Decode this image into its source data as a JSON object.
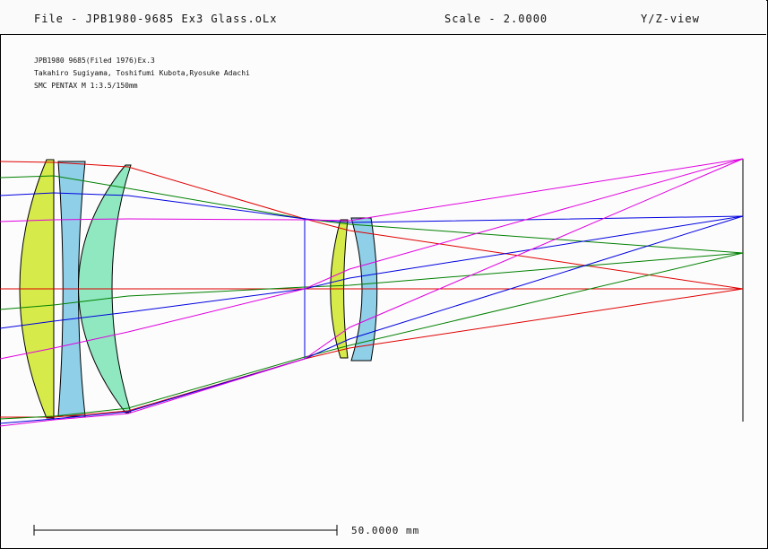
{
  "header": {
    "file_label": "File - JPB1980-9685 Ex3 Glass.oLx",
    "scale_label": "Scale - 2.0000",
    "view_label": "Y/Z-view"
  },
  "info": {
    "line1": "JPB1980 9685(Filed 1976)Ex.3",
    "line2": "Takahiro Sugiyama, Toshifumi Kubota,Ryosuke Adachi",
    "line3": "SMC PENTAX M 1:3.5/150mm"
  },
  "scale_bar": {
    "label": "50.0000 mm"
  },
  "colors": {
    "red": "#e00000",
    "green": "#008000",
    "blue": "#0000e0",
    "magenta": "#e000e0",
    "lens_yellow": "#d6ea4a",
    "lens_blue": "#8fd0e8",
    "lens_mint": "#8fe8c0"
  }
}
